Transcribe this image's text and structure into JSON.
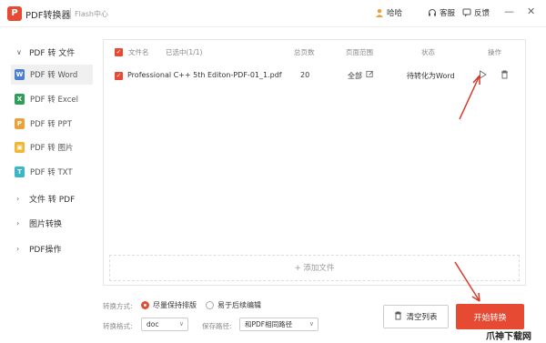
{
  "app": {
    "logo_text": "P",
    "title": "PDF转换器",
    "subtitle": "Flash中心"
  },
  "toolbar": {
    "user": "哈哈",
    "service": "客服",
    "feedback": "反馈"
  },
  "window": {
    "minimize": "—",
    "maximize": "☐",
    "close": "✕"
  },
  "sidebar": {
    "groups": [
      {
        "label": "PDF 转 文件",
        "chev": "∨"
      },
      {
        "label": "文件 转 PDF",
        "chev": "›"
      },
      {
        "label": "图片转换",
        "chev": "›"
      },
      {
        "label": "PDF操作",
        "chev": "›"
      }
    ],
    "items": [
      {
        "label": "PDF 转 Word",
        "icon": "W"
      },
      {
        "label": "PDF 转 Excel",
        "icon": "X"
      },
      {
        "label": "PDF 转 PPT",
        "icon": "P"
      },
      {
        "label": "PDF 转 图片",
        "icon": "▣"
      },
      {
        "label": "PDF 转 TXT",
        "icon": "T"
      }
    ]
  },
  "table": {
    "headers": {
      "filename": "文件名",
      "selected": "已选中(1/1)",
      "pages": "总页数",
      "range": "页面范围",
      "status": "状态",
      "action": "操作"
    },
    "rows": [
      {
        "filename": "Professional C++ 5th Editon-PDF-01_1.pdf",
        "pages": "20",
        "range": "全部",
        "status": "待转化为Word"
      }
    ],
    "add_label": "+ 添加文件"
  },
  "options": {
    "mode_label": "转换方式:",
    "mode_option1": "尽量保持排版",
    "mode_option2": "易于后续编辑",
    "format_label": "转换格式:",
    "format_value": "doc",
    "path_label": "保存路径:",
    "path_value": "和PDF相同路径"
  },
  "buttons": {
    "clear": "清空列表",
    "start": "开始转换"
  },
  "watermark": "爪神下载网",
  "colors": {
    "accent": "#e64a33",
    "word": "#4a7fd4",
    "excel": "#2e9e5b",
    "ppt": "#e8a33a",
    "image": "#f2b632",
    "txt": "#3bb5c9"
  }
}
